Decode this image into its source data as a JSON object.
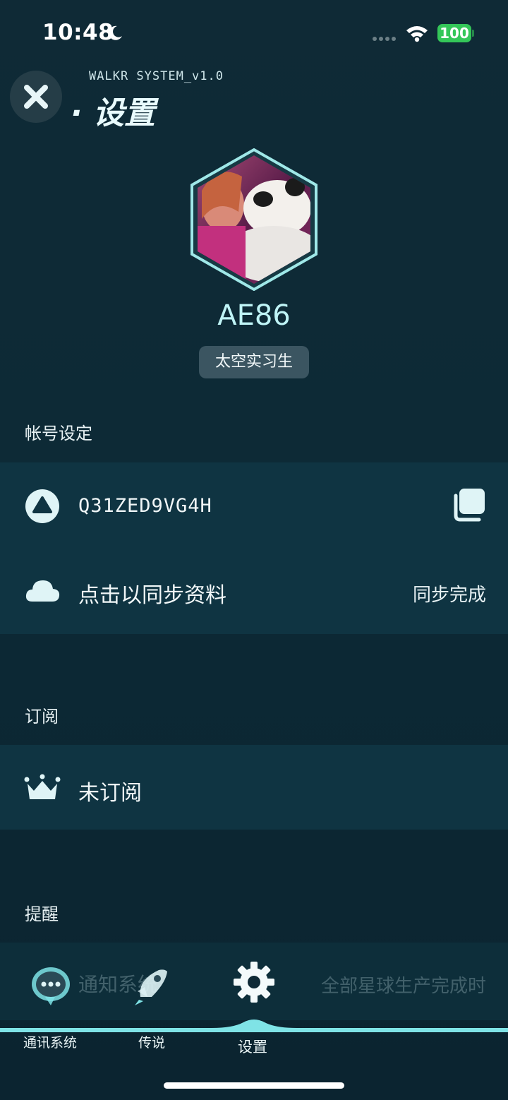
{
  "status_bar": {
    "time": "10:48",
    "battery": "100"
  },
  "header": {
    "system_version": "WALKR SYSTEM_v1.0",
    "title": "· 设置"
  },
  "profile": {
    "name": "AE86",
    "rank": "太空实习生"
  },
  "account_section": {
    "label": "帐号设定",
    "user_id": "Q31ZED9VG4H",
    "sync_label": "点击以同步资料",
    "sync_status": "同步完成"
  },
  "subscription_section": {
    "label": "订阅",
    "status": "未订阅"
  },
  "reminder_section": {
    "label": "提醒",
    "item_label": "通知系统",
    "item_value": "全部星球生产完成时"
  },
  "tab_bar": {
    "tabs": [
      {
        "label": "通讯系统"
      },
      {
        "label": "传说"
      },
      {
        "label": "设置"
      }
    ]
  },
  "colors": {
    "accent": "#7fe3e6",
    "background": "#0f2a36",
    "panel": "#0f3442",
    "badge": "#3b5561"
  }
}
